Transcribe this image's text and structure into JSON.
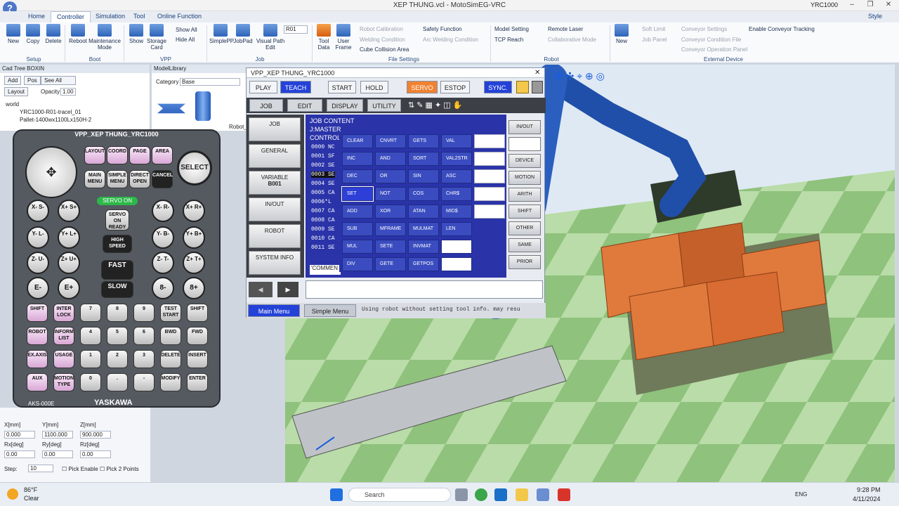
{
  "window": {
    "title": "XEP THUNG.vcl - MotoSimEG-VRC",
    "controller": "YRC1000",
    "style": "Style"
  },
  "tabs": [
    "Home",
    "Controller",
    "Simulation",
    "Tool",
    "Online Function"
  ],
  "ribbon": {
    "setup": {
      "label": "Setup",
      "items": [
        "New",
        "Copy",
        "Delete"
      ]
    },
    "boot": {
      "label": "Boot",
      "items": [
        "Reboot",
        "Maintenance Mode"
      ]
    },
    "vpp": {
      "label": "VPP",
      "items": [
        "Show",
        "Storage Card"
      ],
      "show_all": "Show All",
      "hide_all": "Hide All"
    },
    "job": {
      "label": "Job",
      "items": [
        "SimplePP",
        "JobPad",
        "Visual Path Edit"
      ],
      "robot_sel": "R01"
    },
    "file_settings": {
      "label": "File Settings",
      "items": [
        "Tool Data",
        "User Frame"
      ],
      "robot_calibration": "Robot Calibration",
      "welding_condition": "Welding Condition",
      "cube_collision": "Cube Collision Area",
      "safety_function": "Safety Function",
      "arc_welding": "Arc Welding Condition"
    },
    "robot": {
      "label": "Robot",
      "model_setting": "Model Setting",
      "tcp_reach": "TCP Reach",
      "remote_laser": "Remote Laser",
      "collaborative": "Collaborative Mode"
    },
    "external": {
      "label": "External Device",
      "new": "New",
      "soft_limit": "Soft Limit",
      "job_panel": "Job Panel",
      "conv_settings": "Conveyor Settings",
      "conv_file": "Conveyor Condition File",
      "conv_panel": "Conveyor Operation Panel",
      "enable_tracking": "Enable Conveyor Tracking"
    }
  },
  "cadtree": {
    "title": "Cad Tree BOXIN",
    "add": "Add",
    "pos": "Pos",
    "see_all": "See All",
    "layout": "Layout",
    "opacity_label": "Opacity:",
    "opacity": "1.00",
    "items": [
      "world",
      "YRC1000-R01-tracel_01",
      "Pallet-1400wx1100Lx150H-2"
    ]
  },
  "model_library": {
    "title": "ModelLibrary",
    "category_label": "Category",
    "category": "Base",
    "robot_label": "Robot_"
  },
  "pendant": {
    "title": "VPP_XEP THUNG_YRC1000",
    "model": "AKS-000E",
    "brand": "YASKAWA",
    "select": "SELECT",
    "servo_on": "SERVO ON",
    "servo_ready": "SERVO ON READY",
    "high_speed": "HIGH SPEED",
    "fast": "FAST",
    "slow": "SLOW",
    "top_keys": [
      "LAYOUT",
      "COORD",
      "PAGE",
      "AREA",
      "MAIN MENU",
      "SIMPLE MENU",
      "DIRECT OPEN",
      "CANCEL"
    ],
    "axis_left": [
      "X- S-",
      "X+ S+",
      "Y- L-",
      "Y+ L+",
      "Z- U-",
      "Z+ U+",
      "E-",
      "E+"
    ],
    "axis_right": [
      "X- R-",
      "X+ R+",
      "Y- B-",
      "Y+ B+",
      "Z- T-",
      "Z+ T+",
      "8-",
      "8+"
    ],
    "rows": [
      [
        "SHIFT",
        "INTER LOCK",
        "7",
        "8",
        "9",
        "TEST START",
        "SHIFT"
      ],
      [
        "ROBOT",
        "INFORM LIST",
        "4",
        "5",
        "6",
        "BWD",
        "FWD"
      ],
      [
        "EX.AXIS",
        "USAGE",
        "1",
        "2",
        "3",
        "DELETE",
        "INSERT"
      ],
      [
        "AUX",
        "MOTION TYPE",
        "0",
        ".",
        "-",
        "MODIFY",
        "ENTER"
      ]
    ]
  },
  "coords": {
    "x_label": "X[mm]",
    "y_label": "Y[mm]",
    "z_label": "Z[mm]",
    "x": "0.000",
    "y": "1100.000",
    "z": "900.000",
    "rx_label": "Rx[deg]",
    "ry_label": "Ry[deg]",
    "rz_label": "Rz[deg]",
    "rx": "0.00",
    "ry": "0.00",
    "rz": "0.00",
    "step_label": "Step:",
    "step": "10",
    "pick_enable": "Pick Enable",
    "pick_two": "Pick 2 Points"
  },
  "dialog": {
    "title": "VPP_XEP THUNG_YRC1000",
    "play": "PLAY",
    "teach": "TEACH",
    "start": "START",
    "hold": "HOLD",
    "servo": "SERVO ON",
    "estop": "ESTOP",
    "sync": "SYNC.",
    "menu_tabs": [
      "JOB",
      "EDIT",
      "DISPLAY",
      "UTILITY"
    ],
    "side_menu": [
      "JOB",
      "GENERAL",
      "VARIABLE",
      "IN/OUT",
      "ROBOT",
      "SYSTEM INFO"
    ],
    "variable_val": "B001",
    "job_content": "JOB CONTENT",
    "job_name": "J:MASTER",
    "control": "CONTROL",
    "lines": [
      "0000 NC",
      "0001 SF",
      "0002 SE",
      "0003 SE",
      "0004 SE",
      "0005 CA",
      "0006*L",
      "0007 CA",
      "0008 CA",
      "0009 SE",
      "0010 CA",
      "0011 SE"
    ],
    "comment": "'COMMEN",
    "grid": [
      [
        "CLEAR",
        "CNVRT",
        "GETS",
        "VAL"
      ],
      [
        "INC",
        "AND",
        "SORT",
        "VAL2STR"
      ],
      [
        "DEC",
        "OR",
        "SIN",
        "ASC"
      ],
      [
        "SET",
        "NOT",
        "COS",
        "CHR$"
      ],
      [
        "ADD",
        "XOR",
        "ATAN",
        "MID$"
      ],
      [
        "SUB",
        "MFRAME",
        "MULMAT",
        "LEN"
      ],
      [
        "MUL",
        "SETE",
        "INVMAT",
        ""
      ],
      [
        "DIV",
        "GETE",
        "GETPOS",
        ""
      ]
    ],
    "right_buttons": [
      "IN/OUT",
      "",
      "DEVICE",
      "MOTION",
      "ARITH",
      "SHIFT",
      "OTHER",
      "SAME",
      "PRIOR"
    ],
    "main_menu": "Main Menu",
    "simple_menu": "Simple Menu",
    "status": "Using robot without setting tool info. may resu"
  },
  "taskbar": {
    "temp": "86°F",
    "weather": "Clear",
    "search": "Search",
    "lang": "ENG",
    "time": "9:28 PM",
    "date": "4/11/2024"
  }
}
